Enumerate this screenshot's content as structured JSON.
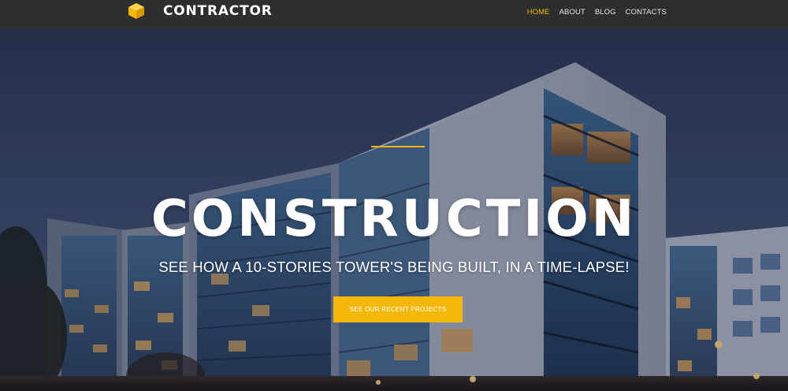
{
  "brand": {
    "name": "CONTRACTOR",
    "icon": "cube-icon",
    "accent_color": "#f4b80c"
  },
  "nav": {
    "items": [
      {
        "label": "HOME",
        "active": true
      },
      {
        "label": "ABOUT",
        "active": false
      },
      {
        "label": "BLOG",
        "active": false
      },
      {
        "label": "CONTACTS",
        "active": false
      }
    ]
  },
  "hero": {
    "title": "CONSTRUCTION",
    "subtitle": "SEE HOW A 10-STORIES TOWER'S BEING BUILT, IN A TIME-LAPSE!",
    "cta_label": "SEE OUR RECENT PROJECTS"
  }
}
